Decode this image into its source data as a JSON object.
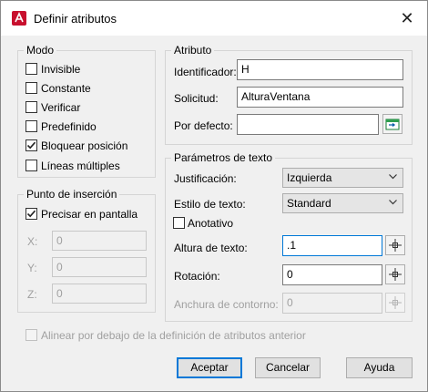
{
  "window": {
    "title": "Definir atributos",
    "close_glyph": "✕"
  },
  "modo": {
    "legend": "Modo",
    "options": [
      {
        "label": "Invisible",
        "checked": false
      },
      {
        "label": "Constante",
        "checked": false
      },
      {
        "label": "Verificar",
        "checked": false
      },
      {
        "label": "Predefinido",
        "checked": false
      },
      {
        "label": "Bloquear posición",
        "checked": true
      },
      {
        "label": "Líneas múltiples",
        "checked": false
      }
    ]
  },
  "punto": {
    "legend": "Punto de inserción",
    "specify_label": "Precisar en pantalla",
    "specify_checked": true,
    "x_label": "X:",
    "x_value": "0",
    "y_label": "Y:",
    "y_value": "0",
    "z_label": "Z:",
    "z_value": "0"
  },
  "atributo": {
    "legend": "Atributo",
    "tag_label": "Identificador:",
    "tag_value": "H",
    "prompt_label": "Solicitud:",
    "prompt_value": "AlturaVentana",
    "default_label": "Por defecto:",
    "default_value": ""
  },
  "texto": {
    "legend": "Parámetros de texto",
    "just_label": "Justificación:",
    "just_value": "Izquierda",
    "style_label": "Estilo de texto:",
    "style_value": "Standard",
    "annotative_label": "Anotativo",
    "annotative_checked": false,
    "height_label": "Altura de texto:",
    "height_value": ".1",
    "rotation_label": "Rotación:",
    "rotation_value": "0",
    "width_label": "Anchura de contorno:",
    "width_value": "0"
  },
  "align_below": {
    "label": "Alinear por debajo de la definición de atributos anterior",
    "checked": false
  },
  "buttons": {
    "ok": "Aceptar",
    "cancel": "Cancelar",
    "help": "Ayuda"
  },
  "icons": {
    "app": "autocad-app-icon",
    "pick": "crosshair-pick-icon",
    "field": "insert-field-icon",
    "dropdown": "chevron-down-icon",
    "check": "checkmark-icon"
  },
  "colors": {
    "focus": "#0078d7",
    "window_bg": "#f0f0f0"
  }
}
